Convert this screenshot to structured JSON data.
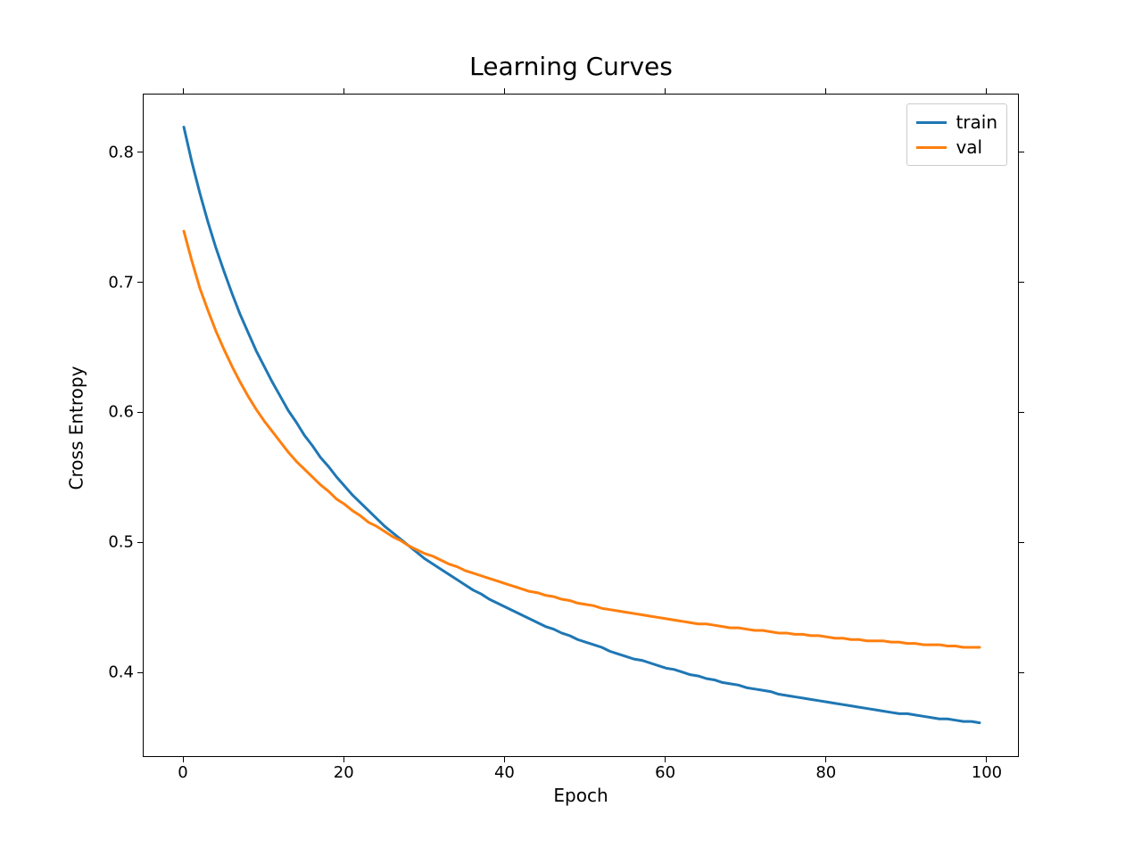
{
  "chart_data": {
    "type": "line",
    "title": "Learning Curves",
    "xlabel": "Epoch",
    "ylabel": "Cross Entropy",
    "xlim": [
      -5,
      104
    ],
    "ylim": [
      0.335,
      0.845
    ],
    "xticks": [
      0,
      20,
      40,
      60,
      80,
      100
    ],
    "yticks": [
      0.4,
      0.5,
      0.6,
      0.7,
      0.8
    ],
    "legend_position": "upper right",
    "series": [
      {
        "name": "train",
        "color": "#1f77b4",
        "x": [
          0,
          1,
          2,
          3,
          4,
          5,
          6,
          7,
          8,
          9,
          10,
          11,
          12,
          13,
          14,
          15,
          16,
          17,
          18,
          19,
          20,
          21,
          22,
          23,
          24,
          25,
          26,
          27,
          28,
          29,
          30,
          31,
          32,
          33,
          34,
          35,
          36,
          37,
          38,
          39,
          40,
          41,
          42,
          43,
          44,
          45,
          46,
          47,
          48,
          49,
          50,
          51,
          52,
          53,
          54,
          55,
          56,
          57,
          58,
          59,
          60,
          61,
          62,
          63,
          64,
          65,
          66,
          67,
          68,
          69,
          70,
          71,
          72,
          73,
          74,
          75,
          76,
          77,
          78,
          79,
          80,
          81,
          82,
          83,
          84,
          85,
          86,
          87,
          88,
          89,
          90,
          91,
          92,
          93,
          94,
          95,
          96,
          97,
          98,
          99
        ],
        "y": [
          0.82,
          0.793,
          0.769,
          0.747,
          0.727,
          0.709,
          0.692,
          0.676,
          0.662,
          0.648,
          0.636,
          0.624,
          0.613,
          0.602,
          0.593,
          0.583,
          0.575,
          0.566,
          0.559,
          0.551,
          0.544,
          0.537,
          0.531,
          0.525,
          0.519,
          0.513,
          0.508,
          0.503,
          0.498,
          0.493,
          0.488,
          0.484,
          0.48,
          0.476,
          0.472,
          0.468,
          0.464,
          0.461,
          0.457,
          0.454,
          0.451,
          0.448,
          0.445,
          0.442,
          0.439,
          0.436,
          0.434,
          0.431,
          0.429,
          0.426,
          0.424,
          0.422,
          0.42,
          0.417,
          0.415,
          0.413,
          0.411,
          0.41,
          0.408,
          0.406,
          0.404,
          0.403,
          0.401,
          0.399,
          0.398,
          0.396,
          0.395,
          0.393,
          0.392,
          0.391,
          0.389,
          0.388,
          0.387,
          0.386,
          0.384,
          0.383,
          0.382,
          0.381,
          0.38,
          0.379,
          0.378,
          0.377,
          0.376,
          0.375,
          0.374,
          0.373,
          0.372,
          0.371,
          0.37,
          0.369,
          0.369,
          0.368,
          0.367,
          0.366,
          0.365,
          0.365,
          0.364,
          0.363,
          0.363,
          0.362
        ]
      },
      {
        "name": "val",
        "color": "#ff7f0e",
        "x": [
          0,
          1,
          2,
          3,
          4,
          5,
          6,
          7,
          8,
          9,
          10,
          11,
          12,
          13,
          14,
          15,
          16,
          17,
          18,
          19,
          20,
          21,
          22,
          23,
          24,
          25,
          26,
          27,
          28,
          29,
          30,
          31,
          32,
          33,
          34,
          35,
          36,
          37,
          38,
          39,
          40,
          41,
          42,
          43,
          44,
          45,
          46,
          47,
          48,
          49,
          50,
          51,
          52,
          53,
          54,
          55,
          56,
          57,
          58,
          59,
          60,
          61,
          62,
          63,
          64,
          65,
          66,
          67,
          68,
          69,
          70,
          71,
          72,
          73,
          74,
          75,
          76,
          77,
          78,
          79,
          80,
          81,
          82,
          83,
          84,
          85,
          86,
          87,
          88,
          89,
          90,
          91,
          92,
          93,
          94,
          95,
          96,
          97,
          98,
          99
        ],
        "y": [
          0.74,
          0.717,
          0.696,
          0.679,
          0.663,
          0.649,
          0.636,
          0.624,
          0.613,
          0.603,
          0.594,
          0.586,
          0.578,
          0.57,
          0.563,
          0.557,
          0.551,
          0.545,
          0.54,
          0.534,
          0.53,
          0.525,
          0.521,
          0.516,
          0.513,
          0.509,
          0.505,
          0.502,
          0.498,
          0.495,
          0.492,
          0.49,
          0.487,
          0.484,
          0.482,
          0.479,
          0.477,
          0.475,
          0.473,
          0.471,
          0.469,
          0.467,
          0.465,
          0.463,
          0.462,
          0.46,
          0.459,
          0.457,
          0.456,
          0.454,
          0.453,
          0.452,
          0.45,
          0.449,
          0.448,
          0.447,
          0.446,
          0.445,
          0.444,
          0.443,
          0.442,
          0.441,
          0.44,
          0.439,
          0.438,
          0.438,
          0.437,
          0.436,
          0.435,
          0.435,
          0.434,
          0.433,
          0.433,
          0.432,
          0.431,
          0.431,
          0.43,
          0.43,
          0.429,
          0.429,
          0.428,
          0.427,
          0.427,
          0.426,
          0.426,
          0.425,
          0.425,
          0.425,
          0.424,
          0.424,
          0.423,
          0.423,
          0.422,
          0.422,
          0.422,
          0.421,
          0.421,
          0.42,
          0.42,
          0.42
        ]
      }
    ]
  }
}
